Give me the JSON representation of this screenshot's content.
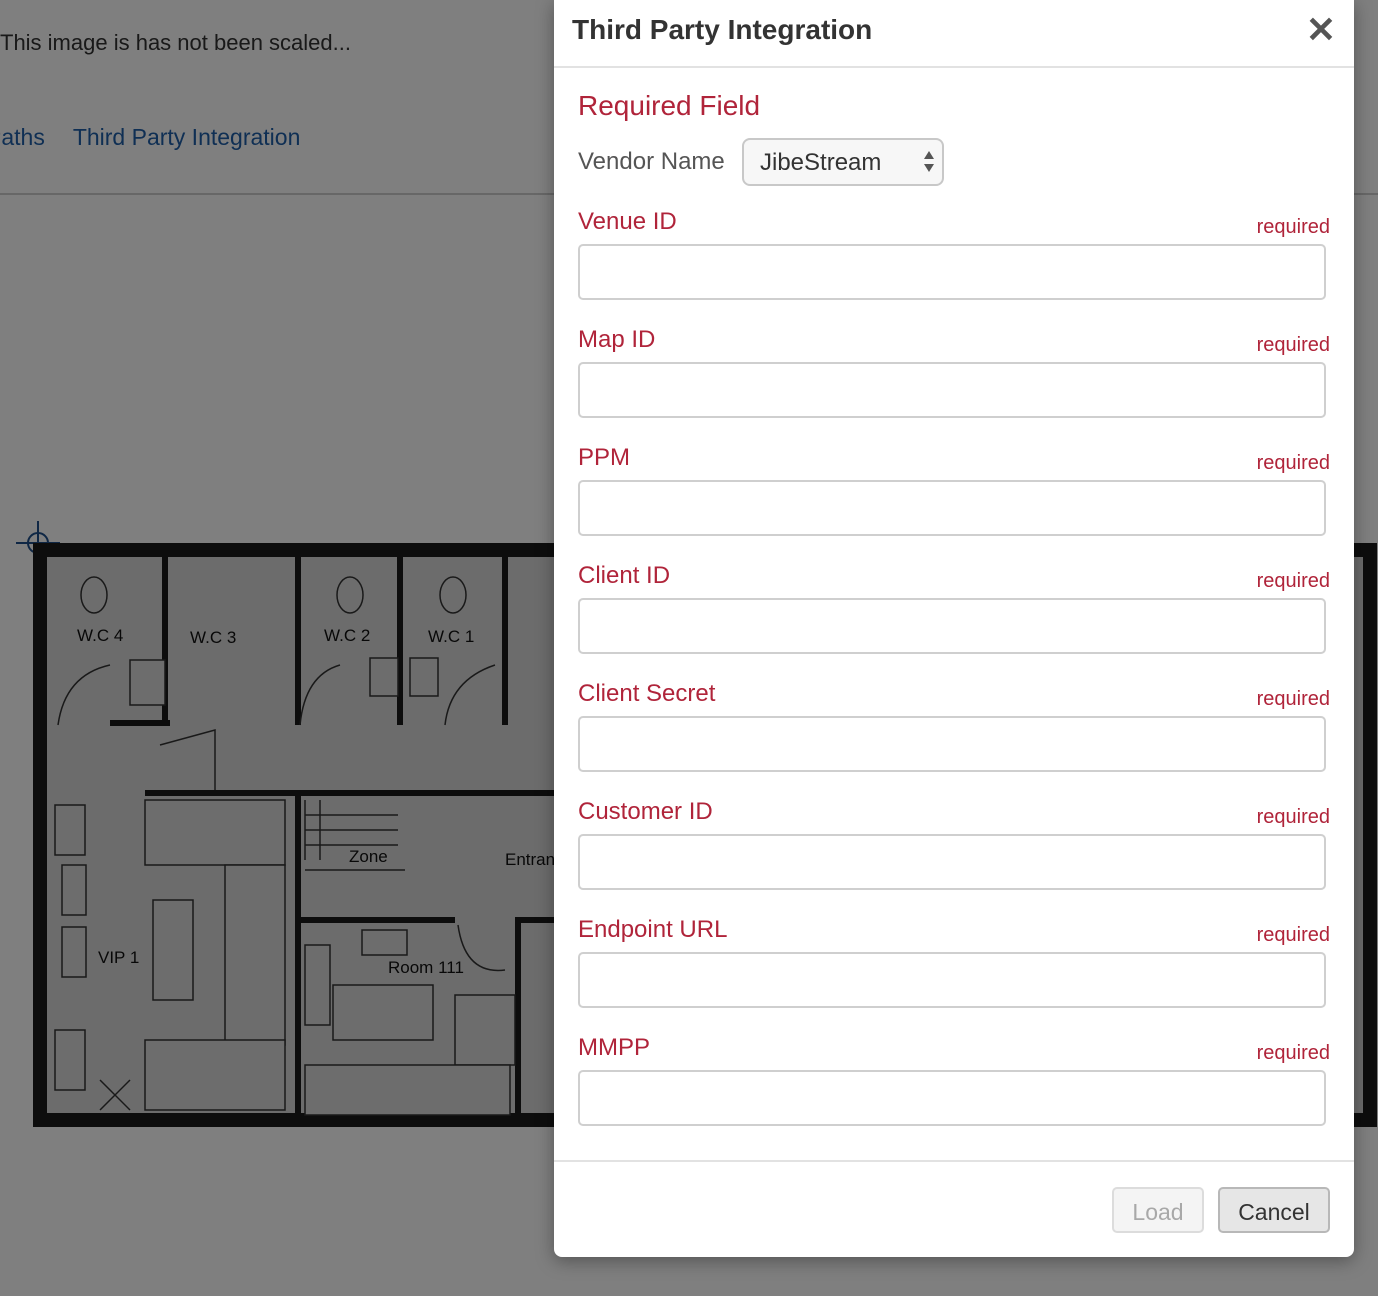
{
  "background": {
    "note": "This image is has not been scaled...",
    "tabs": [
      "Paths",
      "Third Party Integration"
    ],
    "rooms": [
      "W.C 4",
      "W.C 3",
      "W.C 2",
      "W.C 1",
      "Zone",
      "Entran",
      "VIP 1",
      "Room 111"
    ]
  },
  "modal": {
    "title": "Third Party Integration",
    "close_icon": "close-icon",
    "section_title": "Required Field",
    "vendor": {
      "label": "Vendor Name",
      "value": "JibeStream"
    },
    "required_text": "required",
    "fields": [
      {
        "label": "Venue ID",
        "value": ""
      },
      {
        "label": "Map ID",
        "value": ""
      },
      {
        "label": "PPM",
        "value": ""
      },
      {
        "label": "Client ID",
        "value": ""
      },
      {
        "label": "Client Secret",
        "value": ""
      },
      {
        "label": "Customer ID",
        "value": ""
      },
      {
        "label": "Endpoint URL",
        "value": ""
      },
      {
        "label": "MMPP",
        "value": ""
      }
    ],
    "buttons": {
      "load": "Load",
      "cancel": "Cancel"
    }
  },
  "colors": {
    "accent_red": "#b0243a",
    "link_blue": "#1f5fa8"
  }
}
